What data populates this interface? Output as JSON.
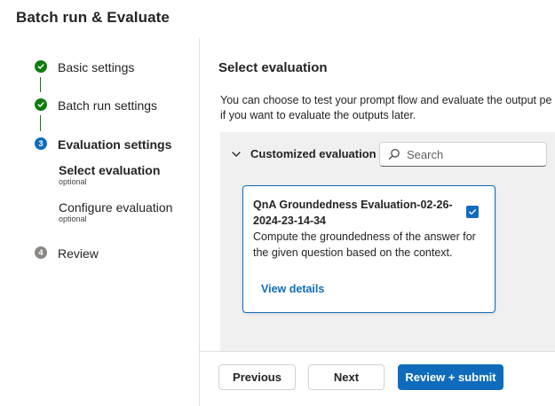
{
  "dialog": {
    "title": "Batch run & Evaluate"
  },
  "steps": [
    {
      "label": "Basic settings",
      "state": "done"
    },
    {
      "label": "Batch run settings",
      "state": "done"
    },
    {
      "number": "3",
      "label": "Evaluation settings",
      "state": "current",
      "substeps": [
        {
          "label": "Select evaluation",
          "note": "optional",
          "active": true
        },
        {
          "label": "Configure evaluation",
          "note": "optional",
          "active": false
        }
      ]
    },
    {
      "number": "4",
      "label": "Review",
      "state": "pending"
    }
  ],
  "main": {
    "title": "Select evaluation",
    "description_line1": "You can choose to test your prompt flow and evaluate the output pe",
    "description_line2": "if you want to evaluate the outputs later.",
    "group": {
      "label": "Customized evaluation",
      "icon": "chevron-down-icon",
      "search": {
        "placeholder": "Search",
        "value": "",
        "icon": "search-icon"
      }
    },
    "card": {
      "title": "QnA Groundedness Evaluation-02-26-2024-23-14-34",
      "description": "Compute the groundedness of the answer for the given question based on the context.",
      "link": "View details",
      "checked": true
    }
  },
  "footer": {
    "previous_label": "Previous",
    "next_label": "Next",
    "submit_label": "Review + submit"
  },
  "colors": {
    "accent": "#0f6cbd",
    "success": "#107c10",
    "panel_bg": "#f0f0f0",
    "pending": "#8a8886"
  }
}
